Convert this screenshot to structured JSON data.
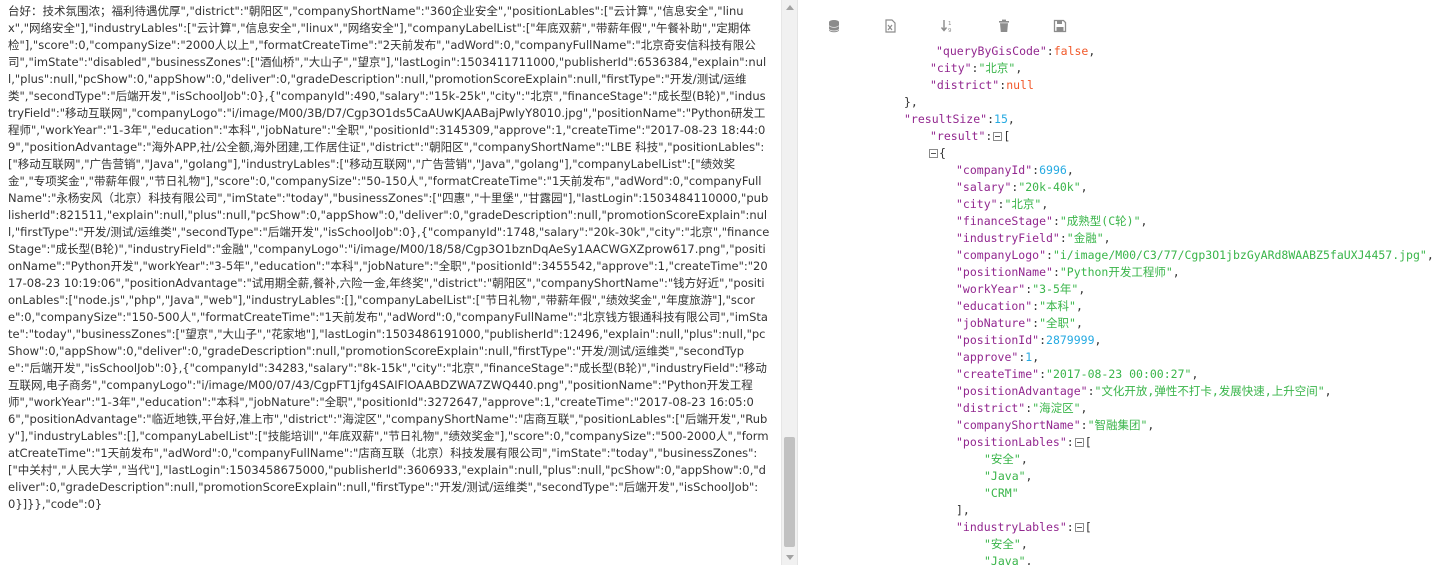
{
  "left_panel": {
    "raw_text": "台好：技术氛围浓；福利待遇优厚\",\"district\":\"朝阳区\",\"companyShortName\":\"360企业安全\",\"positionLables\":[\"云计算\",\"信息安全\",\"linux\",\"网络安全\"],\"industryLables\":[\"云计算\",\"信息安全\",\"linux\",\"网络安全\"],\"companyLabelList\":[\"年底双薪\",\"带薪年假\",\"午餐补助\",\"定期体检\"],\"score\":0,\"companySize\":\"2000人以上\",\"formatCreateTime\":\"2天前发布\",\"adWord\":0,\"companyFullName\":\"北京奇安信科技有限公司\",\"imState\":\"disabled\",\"businessZones\":[\"酒仙桥\",\"大山子\",\"望京\"],\"lastLogin\":1503411711000,\"publisherId\":6536384,\"explain\":null,\"plus\":null,\"pcShow\":0,\"appShow\":0,\"deliver\":0,\"gradeDescription\":null,\"promotionScoreExplain\":null,\"firstType\":\"开发/测试/运维类\",\"secondType\":\"后端开发\",\"isSchoolJob\":0},{\"companyId\":490,\"salary\":\"15k-25k\",\"city\":\"北京\",\"financeStage\":\"成长型(B轮)\",\"industryField\":\"移动互联网\",\"companyLogo\":\"i/image/M00/3B/D7/Cgp3O1ds5CaAUwKJAABajPwlyY8010.jpg\",\"positionName\":\"Python研发工程师\",\"workYear\":\"1-3年\",\"education\":\"本科\",\"jobNature\":\"全职\",\"positionId\":3145309,\"approve\":1,\"createTime\":\"2017-08-23 18:44:09\",\"positionAdvantage\":\"海外APP,社/公全额,海外团建,工作居住证\",\"district\":\"朝阳区\",\"companyShortName\":\"LBE 科技\",\"positionLables\":[\"移动互联网\",\"广告营销\",\"Java\",\"golang\"],\"industryLables\":[\"移动互联网\",\"广告营销\",\"Java\",\"golang\"],\"companyLabelList\":[\"绩效奖金\",\"专项奖金\",\"带薪年假\",\"节日礼物\"],\"score\":0,\"companySize\":\"50-150人\",\"formatCreateTime\":\"1天前发布\",\"adWord\":0,\"companyFullName\":\"永杨安风（北京）科技有限公司\",\"imState\":\"today\",\"businessZones\":[\"四惠\",\"十里堡\",\"甘露园\"],\"lastLogin\":1503484110000,\"publisherId\":821511,\"explain\":null,\"plus\":null,\"pcShow\":0,\"appShow\":0,\"deliver\":0,\"gradeDescription\":null,\"promotionScoreExplain\":null,\"firstType\":\"开发/测试/运维类\",\"secondType\":\"后端开发\",\"isSchoolJob\":0},{\"companyId\":1748,\"salary\":\"20k-30k\",\"city\":\"北京\",\"financeStage\":\"成长型(B轮)\",\"industryField\":\"金融\",\"companyLogo\":\"i/image/M00/18/58/Cgp3O1bznDqAeSy1AACWGXZprow617.png\",\"positionName\":\"Python开发\",\"workYear\":\"3-5年\",\"education\":\"本科\",\"jobNature\":\"全职\",\"positionId\":3455542,\"approve\":1,\"createTime\":\"2017-08-23 10:19:06\",\"positionAdvantage\":\"试用期全薪,餐补,六险一金,年终奖\",\"district\":\"朝阳区\",\"companyShortName\":\"钱方好近\",\"positionLables\":[\"node.js\",\"php\",\"Java\",\"web\"],\"industryLables\":[],\"companyLabelList\":[\"节日礼物\",\"带薪年假\",\"绩效奖金\",\"年度旅游\"],\"score\":0,\"companySize\":\"150-500人\",\"formatCreateTime\":\"1天前发布\",\"adWord\":0,\"companyFullName\":\"北京钱方银通科技有限公司\",\"imState\":\"today\",\"businessZones\":[\"望京\",\"大山子\",\"花家地\"],\"lastLogin\":1503486191000,\"publisherId\":12496,\"explain\":null,\"plus\":null,\"pcShow\":0,\"appShow\":0,\"deliver\":0,\"gradeDescription\":null,\"promotionScoreExplain\":null,\"firstType\":\"开发/测试/运维类\",\"secondType\":\"后端开发\",\"isSchoolJob\":0},{\"companyId\":34283,\"salary\":\"8k-15k\",\"city\":\"北京\",\"financeStage\":\"成长型(B轮)\",\"industryField\":\"移动互联网,电子商务\",\"companyLogo\":\"i/image/M00/07/43/CgpFT1jfg4SAIFlOAABDZWA7ZWQ440.png\",\"positionName\":\"Python开发工程师\",\"workYear\":\"1-3年\",\"education\":\"本科\",\"jobNature\":\"全职\",\"positionId\":3272647,\"approve\":1,\"createTime\":\"2017-08-23 16:05:06\",\"positionAdvantage\":\"临近地铁,平台好,准上市\",\"district\":\"海淀区\",\"companyShortName\":\"店商互联\",\"positionLables\":[\"后端开发\",\"Ruby\"],\"industryLables\":[],\"companyLabelList\":[\"技能培训\",\"年底双薪\",\"节日礼物\",\"绩效奖金\"],\"score\":0,\"companySize\":\"500-2000人\",\"formatCreateTime\":\"1天前发布\",\"adWord\":0,\"companyFullName\":\"店商互联（北京）科技发展有限公司\",\"imState\":\"today\",\"businessZones\":[\"中关村\",\"人民大学\",\"当代\"],\"lastLogin\":1503458675000,\"publisherId\":3606933,\"explain\":null,\"plus\":null,\"pcShow\":0,\"appShow\":0,\"deliver\":0,\"gradeDescription\":null,\"promotionScoreExplain\":null,\"firstType\":\"开发/测试/运维类\",\"secondType\":\"后端开发\",\"isSchoolJob\":0}]}},\"code\":0}"
  },
  "toolbar": {
    "buttons": [
      {
        "icon": "database-icon"
      },
      {
        "icon": "excel-icon"
      },
      {
        "icon": "sort-numeric-icon"
      },
      {
        "icon": "trash-icon"
      },
      {
        "icon": "save-icon"
      }
    ]
  },
  "colors": {
    "key": "#92278f",
    "string": "#3ab54a",
    "number": "#25aae2",
    "null": "#f1592a",
    "punctuation": "#333333"
  },
  "json_view": {
    "lines": [
      {
        "type": "kv",
        "key": "\"queryByGisCode\"",
        "value": "false",
        "vt": "nul",
        "comma": ","
      },
      {
        "type": "kv",
        "key": "\"city\"",
        "value": "\"北京\"",
        "vt": "s",
        "comma": ","
      },
      {
        "type": "kv",
        "key": "\"district\"",
        "value": "null",
        "vt": "nul",
        "comma": ""
      },
      {
        "type": "p",
        "text": "},"
      },
      {
        "type": "kv",
        "key": "\"resultSize\"",
        "value": "15",
        "vt": "n",
        "comma": ","
      },
      {
        "type": "open",
        "key": "\"result\"",
        "bracket": "["
      },
      {
        "type": "openp",
        "bracket": "{"
      },
      {
        "type": "kv",
        "key": "\"companyId\"",
        "value": "6996",
        "vt": "n",
        "comma": ","
      },
      {
        "type": "kv",
        "key": "\"salary\"",
        "value": "\"20k-40k\"",
        "vt": "s",
        "comma": ","
      },
      {
        "type": "kv",
        "key": "\"city\"",
        "value": "\"北京\"",
        "vt": "s",
        "comma": ","
      },
      {
        "type": "kv",
        "key": "\"financeStage\"",
        "value": "\"成熟型(C轮)\"",
        "vt": "s",
        "comma": ","
      },
      {
        "type": "kv",
        "key": "\"industryField\"",
        "value": "\"金融\"",
        "vt": "s",
        "comma": ","
      },
      {
        "type": "kv",
        "key": "\"companyLogo\"",
        "value": "\"i/image/M00/C3/77/Cgp3O1jbzGyARd8WAABZ5faUXJ4457.jpg\"",
        "vt": "s",
        "comma": ","
      },
      {
        "type": "kv",
        "key": "\"positionName\"",
        "value": "\"Python开发工程师\"",
        "vt": "s",
        "comma": ","
      },
      {
        "type": "kv",
        "key": "\"workYear\"",
        "value": "\"3-5年\"",
        "vt": "s",
        "comma": ","
      },
      {
        "type": "kv",
        "key": "\"education\"",
        "value": "\"本科\"",
        "vt": "s",
        "comma": ","
      },
      {
        "type": "kv",
        "key": "\"jobNature\"",
        "value": "\"全职\"",
        "vt": "s",
        "comma": ","
      },
      {
        "type": "kv",
        "key": "\"positionId\"",
        "value": "2879999",
        "vt": "n",
        "comma": ","
      },
      {
        "type": "kv",
        "key": "\"approve\"",
        "value": "1",
        "vt": "n",
        "comma": ","
      },
      {
        "type": "kv",
        "key": "\"createTime\"",
        "value": "\"2017-08-23 00:00:27\"",
        "vt": "s",
        "comma": ","
      },
      {
        "type": "kv",
        "key": "\"positionAdvantage\"",
        "value": "\"文化开放,弹性不打卡,发展快速,上升空间\"",
        "vt": "s",
        "comma": ","
      },
      {
        "type": "kv",
        "key": "\"district\"",
        "value": "\"海淀区\"",
        "vt": "s",
        "comma": ","
      },
      {
        "type": "kv",
        "key": "\"companyShortName\"",
        "value": "\"智融集团\"",
        "vt": "s",
        "comma": ","
      },
      {
        "type": "open",
        "key": "\"positionLables\"",
        "bracket": "["
      },
      {
        "type": "v",
        "value": "\"安全\"",
        "vt": "s",
        "comma": ","
      },
      {
        "type": "v",
        "value": "\"Java\"",
        "vt": "s",
        "comma": ","
      },
      {
        "type": "v",
        "value": "\"CRM\"",
        "vt": "s",
        "comma": ""
      },
      {
        "type": "p",
        "text": "],"
      },
      {
        "type": "open",
        "key": "\"industryLables\"",
        "bracket": "["
      },
      {
        "type": "v",
        "value": "\"安全\"",
        "vt": "s",
        "comma": ","
      },
      {
        "type": "v",
        "value": "\"Java\"",
        "vt": "s",
        "comma": ","
      }
    ]
  }
}
